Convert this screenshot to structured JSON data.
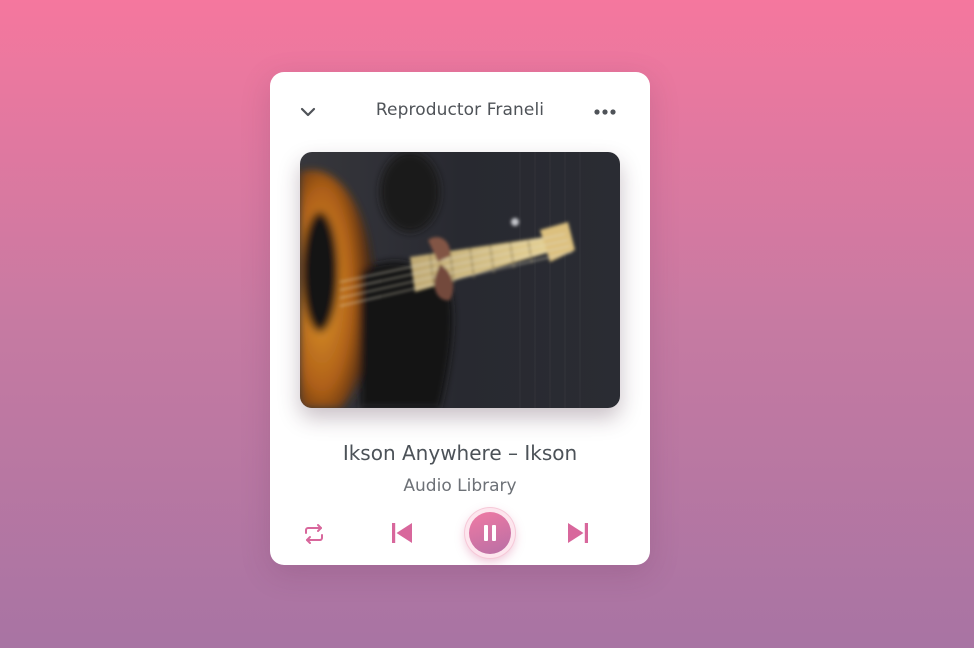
{
  "player": {
    "title": "Reproductor Franeli",
    "song_title": "Ikson Anywhere – Ikson",
    "artist": "Audio Library",
    "state": "playing"
  },
  "header": {
    "collapse_icon": "chevron-down-icon",
    "menu_icon": "more-horizontal-icon"
  },
  "controls": {
    "repeat_icon": "repeat-icon",
    "prev_icon": "skip-previous-icon",
    "play_pause_icon": "pause-icon",
    "next_icon": "skip-next-icon"
  },
  "colors": {
    "accent": "#d8679c",
    "background_top": "#f5779e",
    "background_bottom": "#a874a3",
    "text": "#4f5358"
  }
}
